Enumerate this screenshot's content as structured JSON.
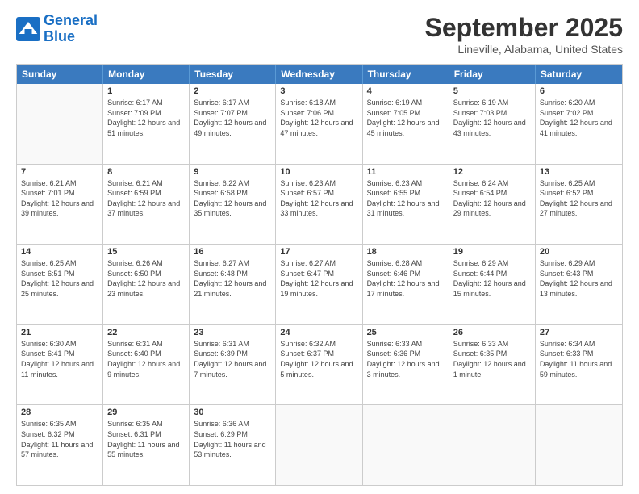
{
  "header": {
    "logo_line1": "General",
    "logo_line2": "Blue",
    "title": "September 2025",
    "subtitle": "Lineville, Alabama, United States"
  },
  "days_of_week": [
    "Sunday",
    "Monday",
    "Tuesday",
    "Wednesday",
    "Thursday",
    "Friday",
    "Saturday"
  ],
  "weeks": [
    [
      {
        "day": null
      },
      {
        "day": 1,
        "sunrise": "6:17 AM",
        "sunset": "7:09 PM",
        "daylight": "12 hours and 51 minutes."
      },
      {
        "day": 2,
        "sunrise": "6:17 AM",
        "sunset": "7:07 PM",
        "daylight": "12 hours and 49 minutes."
      },
      {
        "day": 3,
        "sunrise": "6:18 AM",
        "sunset": "7:06 PM",
        "daylight": "12 hours and 47 minutes."
      },
      {
        "day": 4,
        "sunrise": "6:19 AM",
        "sunset": "7:05 PM",
        "daylight": "12 hours and 45 minutes."
      },
      {
        "day": 5,
        "sunrise": "6:19 AM",
        "sunset": "7:03 PM",
        "daylight": "12 hours and 43 minutes."
      },
      {
        "day": 6,
        "sunrise": "6:20 AM",
        "sunset": "7:02 PM",
        "daylight": "12 hours and 41 minutes."
      }
    ],
    [
      {
        "day": 7,
        "sunrise": "6:21 AM",
        "sunset": "7:01 PM",
        "daylight": "12 hours and 39 minutes."
      },
      {
        "day": 8,
        "sunrise": "6:21 AM",
        "sunset": "6:59 PM",
        "daylight": "12 hours and 37 minutes."
      },
      {
        "day": 9,
        "sunrise": "6:22 AM",
        "sunset": "6:58 PM",
        "daylight": "12 hours and 35 minutes."
      },
      {
        "day": 10,
        "sunrise": "6:23 AM",
        "sunset": "6:57 PM",
        "daylight": "12 hours and 33 minutes."
      },
      {
        "day": 11,
        "sunrise": "6:23 AM",
        "sunset": "6:55 PM",
        "daylight": "12 hours and 31 minutes."
      },
      {
        "day": 12,
        "sunrise": "6:24 AM",
        "sunset": "6:54 PM",
        "daylight": "12 hours and 29 minutes."
      },
      {
        "day": 13,
        "sunrise": "6:25 AM",
        "sunset": "6:52 PM",
        "daylight": "12 hours and 27 minutes."
      }
    ],
    [
      {
        "day": 14,
        "sunrise": "6:25 AM",
        "sunset": "6:51 PM",
        "daylight": "12 hours and 25 minutes."
      },
      {
        "day": 15,
        "sunrise": "6:26 AM",
        "sunset": "6:50 PM",
        "daylight": "12 hours and 23 minutes."
      },
      {
        "day": 16,
        "sunrise": "6:27 AM",
        "sunset": "6:48 PM",
        "daylight": "12 hours and 21 minutes."
      },
      {
        "day": 17,
        "sunrise": "6:27 AM",
        "sunset": "6:47 PM",
        "daylight": "12 hours and 19 minutes."
      },
      {
        "day": 18,
        "sunrise": "6:28 AM",
        "sunset": "6:46 PM",
        "daylight": "12 hours and 17 minutes."
      },
      {
        "day": 19,
        "sunrise": "6:29 AM",
        "sunset": "6:44 PM",
        "daylight": "12 hours and 15 minutes."
      },
      {
        "day": 20,
        "sunrise": "6:29 AM",
        "sunset": "6:43 PM",
        "daylight": "12 hours and 13 minutes."
      }
    ],
    [
      {
        "day": 21,
        "sunrise": "6:30 AM",
        "sunset": "6:41 PM",
        "daylight": "12 hours and 11 minutes."
      },
      {
        "day": 22,
        "sunrise": "6:31 AM",
        "sunset": "6:40 PM",
        "daylight": "12 hours and 9 minutes."
      },
      {
        "day": 23,
        "sunrise": "6:31 AM",
        "sunset": "6:39 PM",
        "daylight": "12 hours and 7 minutes."
      },
      {
        "day": 24,
        "sunrise": "6:32 AM",
        "sunset": "6:37 PM",
        "daylight": "12 hours and 5 minutes."
      },
      {
        "day": 25,
        "sunrise": "6:33 AM",
        "sunset": "6:36 PM",
        "daylight": "12 hours and 3 minutes."
      },
      {
        "day": 26,
        "sunrise": "6:33 AM",
        "sunset": "6:35 PM",
        "daylight": "12 hours and 1 minute."
      },
      {
        "day": 27,
        "sunrise": "6:34 AM",
        "sunset": "6:33 PM",
        "daylight": "11 hours and 59 minutes."
      }
    ],
    [
      {
        "day": 28,
        "sunrise": "6:35 AM",
        "sunset": "6:32 PM",
        "daylight": "11 hours and 57 minutes."
      },
      {
        "day": 29,
        "sunrise": "6:35 AM",
        "sunset": "6:31 PM",
        "daylight": "11 hours and 55 minutes."
      },
      {
        "day": 30,
        "sunrise": "6:36 AM",
        "sunset": "6:29 PM",
        "daylight": "11 hours and 53 minutes."
      },
      {
        "day": null
      },
      {
        "day": null
      },
      {
        "day": null
      },
      {
        "day": null
      }
    ]
  ]
}
